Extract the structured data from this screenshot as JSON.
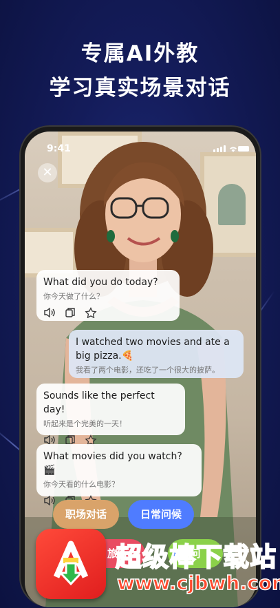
{
  "headline": {
    "line1": "专属AI外教",
    "line2": "学习真实场景对话"
  },
  "status_bar": {
    "time": "9:41"
  },
  "chat": [
    {
      "role": "ai",
      "en": "What did you do today?",
      "zh": "你今天做了什么？"
    },
    {
      "role": "user",
      "en": "I watched two movies and ate a big pizza.🍕",
      "zh": "我看了两个电影，还吃了一个很大的披萨。"
    },
    {
      "role": "ai",
      "en": "Sounds like the perfect day!",
      "zh": "听起来是个完美的一天！"
    },
    {
      "role": "ai",
      "en": "What movies did you watch? 🎬",
      "zh": "你今天看的什么电影？"
    }
  ],
  "topics": [
    {
      "label": "职场对话",
      "color": "#d9a36a"
    },
    {
      "label": "日常问候",
      "color": "#4f7cff"
    },
    {
      "label": "旅行",
      "color": "#e94c62"
    },
    {
      "label": "问",
      "color": "#8bd14a"
    }
  ],
  "watermark": {
    "name": "超级棒下载站",
    "url": "www.cjbwh.com"
  },
  "icons": {
    "close": "close-icon",
    "speaker": "speaker-icon",
    "copy": "copy-icon",
    "star": "star-icon"
  }
}
